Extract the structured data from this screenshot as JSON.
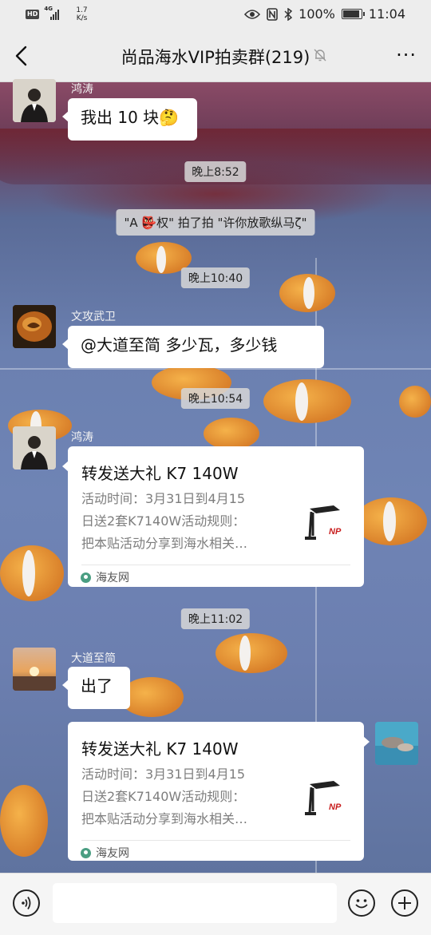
{
  "status_bar": {
    "hd_badge": "HD",
    "network_type": "4G",
    "net_speed_value": "1.7",
    "net_speed_unit": "K/s",
    "battery_percent": "100%",
    "time": "11:04"
  },
  "nav": {
    "title": "尚品海水VIP拍卖群(219)",
    "more_label": "···",
    "icons": [
      "back-arrow-icon",
      "mute-bell-icon",
      "more-icon"
    ]
  },
  "messages": [
    {
      "type": "text",
      "side": "left",
      "sender": "鸿涛",
      "text": "我出 10 块🤔"
    },
    {
      "type": "time",
      "text": "晚上8:52"
    },
    {
      "type": "system",
      "text": "\"A 👺权\" 拍了拍 \"许你放歌纵马ζ\""
    },
    {
      "type": "time",
      "text": "晚上10:40"
    },
    {
      "type": "text",
      "side": "left",
      "sender": "文攻武卫",
      "text": "@大道至简  多少瓦，多少钱"
    },
    {
      "type": "time",
      "text": "晚上10:54"
    },
    {
      "type": "card",
      "side": "left",
      "sender": "鸿涛",
      "title": "转发送大礼 K7 140W",
      "desc_lines": [
        "活动时间：3月31日到4月15",
        "日送2套K7140W活动规则：",
        "把本贴活动分享到海水相关…"
      ],
      "source": "海友网",
      "thumb_brand": "NP"
    },
    {
      "type": "time",
      "text": "晚上11:02"
    },
    {
      "type": "text",
      "side": "left",
      "sender": "大道至简",
      "text": "出了"
    },
    {
      "type": "card",
      "side": "right",
      "title": "转发送大礼 K7 140W",
      "desc_lines": [
        "活动时间：3月31日到4月15",
        "日送2套K7140W活动规则：",
        "把本贴活动分享到海水相关…"
      ],
      "source": "海友网",
      "thumb_brand": "NP"
    }
  ],
  "input_bar": {
    "placeholder": "",
    "icons": [
      "voice-icon",
      "emoji-icon",
      "plus-icon"
    ]
  },
  "colors": {
    "bar_bg": "#ededed",
    "bubble_bg": "#ffffff",
    "time_pill_bg": "#d7d7d7",
    "source_icon": "#4a9e82",
    "np_logo": "#c81e1e"
  }
}
